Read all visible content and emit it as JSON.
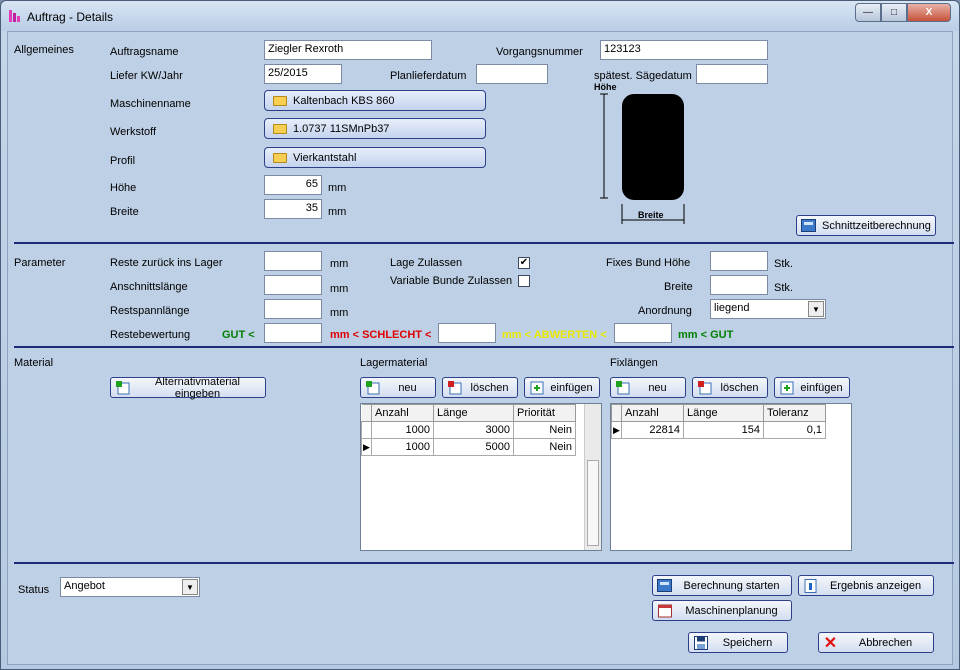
{
  "window": {
    "title": "Auftrag - Details",
    "min": "—",
    "max": "□",
    "close": "X"
  },
  "allgemeines": {
    "section": "Allgemeines",
    "auftragsname_label": "Auftragsname",
    "auftragsname": "Ziegler Rexroth",
    "vorgangsnummer_label": "Vorgangsnummer",
    "vorgangsnummer": "123123",
    "liefer_label": "Liefer KW/Jahr",
    "liefer": "25/2015",
    "planliefer_label": "Planlieferdatum",
    "planliefer": "",
    "saege_label": "spätest. Sägedatum",
    "saege": "",
    "maschine_label": "Maschinenname",
    "maschine": "Kaltenbach KBS 860",
    "werkstoff_label": "Werkstoff",
    "werkstoff": "1.0737 11SMnPb37",
    "profil_label": "Profil",
    "profil": "Vierkantstahl",
    "hoehe_label": "Höhe",
    "hoehe": "65",
    "hoehe_unit": "mm",
    "breite_label": "Breite",
    "breite": "35",
    "breite_unit": "mm",
    "diagram_hoehe": "Höhe",
    "diagram_breite": "Breite",
    "schnittzeit_btn": "Schnittzeitberechnung"
  },
  "parameter": {
    "section": "Parameter",
    "reste_label": "Reste zurück ins Lager",
    "reste": "",
    "reste_unit": "mm",
    "anschnitt_label": "Anschnittslänge",
    "anschnitt": "",
    "anschnitt_unit": "mm",
    "restspann_label": "Restspannlänge",
    "restspann": "",
    "restspann_unit": "mm",
    "restebewertung_label": "Restebewertung",
    "gut1": "GUT <",
    "schlecht": "mm < SCHLECHT <",
    "abwerten": "mm < ABWERTEN <",
    "gut2": "mm < GUT",
    "lage_label": "Lage Zulassen",
    "lage_checked": "✔",
    "variable_label": "Variable Bunde Zulassen",
    "variable_checked": "",
    "fixes_label": "Fixes Bund",
    "fixes_hoehe_label": "Höhe",
    "fixes_hoehe_unit": "Stk.",
    "fixes_breite_label": "Breite",
    "fixes_breite_unit": "Stk.",
    "anordnung_label": "Anordnung",
    "anordnung": "liegend"
  },
  "material": {
    "section": "Material",
    "alternativ_btn": "Alternativmaterial eingeben",
    "lager_title": "Lagermaterial",
    "fix_title": "Fixlängen",
    "neu": "neu",
    "loeschen": "löschen",
    "einfuegen": "einfügen",
    "lager_cols": [
      "Anzahl",
      "Länge",
      "Priorität"
    ],
    "lager_rows": [
      [
        "1000",
        "3000",
        "Nein"
      ],
      [
        "1000",
        "5000",
        "Nein"
      ]
    ],
    "fix_cols": [
      "Anzahl",
      "Länge",
      "Toleranz"
    ],
    "fix_rows": [
      [
        "22814",
        "154",
        "0,1"
      ]
    ]
  },
  "footer": {
    "status_label": "Status",
    "status": "Angebot",
    "berechnung_btn": "Berechnung starten",
    "ergebnis_btn": "Ergebnis anzeigen",
    "maschinenplanung_btn": "Maschinenplanung",
    "speichern_btn": "Speichern",
    "abbrechen_btn": "Abbrechen"
  }
}
